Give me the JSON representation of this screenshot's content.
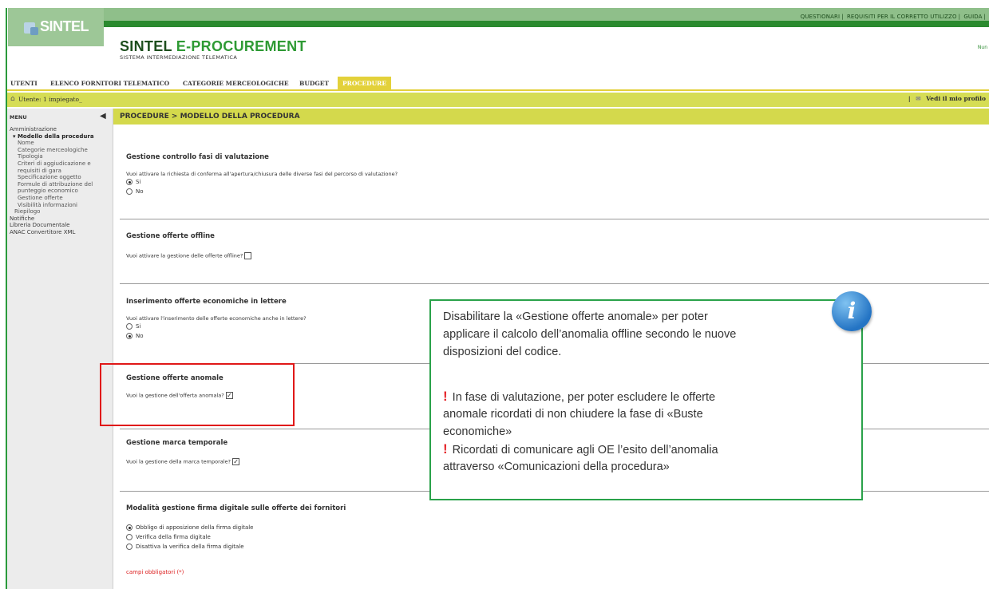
{
  "header": {
    "top_links": [
      "QUESTIONARI",
      "REQUISITI PER IL CORRETTO UTILIZZO",
      "GUIDA"
    ],
    "logo_text": "SINTEL",
    "app_title_part1": "SINTEL ",
    "app_title_part2": "E-PROCUREMENT",
    "app_subtitle": "SISTEMA INTERMEDIAZIONE TELEMATICA",
    "right_fragment": "Nun"
  },
  "nav": {
    "tabs": [
      "UTENTI",
      "ELENCO FORNITORI TELEMATICO",
      "CATEGORIE MERCEOLOGICHE",
      "BUDGET",
      "PROCEDURE"
    ]
  },
  "userbar": {
    "user": "Utente: 1 impiegato_",
    "profile": "Vedi il mio profilo",
    "separator": "|"
  },
  "sidebar": {
    "menu_label": "MENU",
    "items": [
      "Amministrazione",
      "▾ Modello della procedura",
      "Nome",
      "Categorie merceologiche",
      "Tipologia",
      "Criteri di aggiudicazione e",
      "requisiti di gara",
      "Specificazione oggetto",
      "Formule di attribuzione del",
      "punteggio economico",
      "Gestione offerte",
      "Visibilità informazioni",
      "Riepilogo",
      "Notifiche",
      "Libreria Documentale",
      "ANAC Convertitore XML"
    ]
  },
  "breadcrumb": "PROCEDURE  > MODELLO DELLA PROCEDURA",
  "sections": {
    "s1_title": "Gestione controllo fasi di valutazione",
    "s1_q": "Vuoi attivare la richiesta di conferma all'apertura/chiusura delle diverse fasi del percorso di valutazione?",
    "s1_opt1": "Si",
    "s1_opt2": "No",
    "s2_title": "Gestione offerte offline",
    "s2_q": "Vuoi attivare la gestione delle offerte offline?",
    "s3_title": "Inserimento offerte economiche in lettere",
    "s3_q": "Vuoi attivare l'inserimento delle offerte economiche anche in lettere?",
    "s3_opt1": "Si",
    "s3_opt2": "No",
    "s4_title": "Gestione offerte anomale",
    "s4_q": "Vuoi la gestione dell'offerta anomala?",
    "s5_title": "Gestione marca temporale",
    "s5_q": "Vuoi la gestione della marca temporale?",
    "s6_title": "Modalità gestione firma digitale sulle offerte dei fornitori",
    "s6_opt1": "Obbligo di apposizione della firma digitale",
    "s6_opt2": "Verifica della firma digitale",
    "s6_opt3": "Disattiva la verifica della firma digitale",
    "required": "campi obbligatori (*)"
  },
  "callout": {
    "line1": "Disabilitare la «Gestione offerte anomale» per poter",
    "line2": "applicare il calcolo dell’anomalia offline secondo le nuove",
    "line3": "disposizioni del codice.",
    "line4": "In fase di valutazione, per poter escludere le offerte",
    "line5": "anomale ricordati di non chiudere la fase di «Buste",
    "line6": "economiche»",
    "line7": "Ricordati di comunicare agli OE l’esito dell’anomalia",
    "line8": "attraverso «Comunicazioni della procedura»",
    "icon_glyph": "i"
  },
  "colors": {
    "accent_green": "#2b8a2f",
    "yellow_bar": "#d4d94c",
    "highlight_red": "#e01818",
    "callout_border": "#2aa24a"
  }
}
